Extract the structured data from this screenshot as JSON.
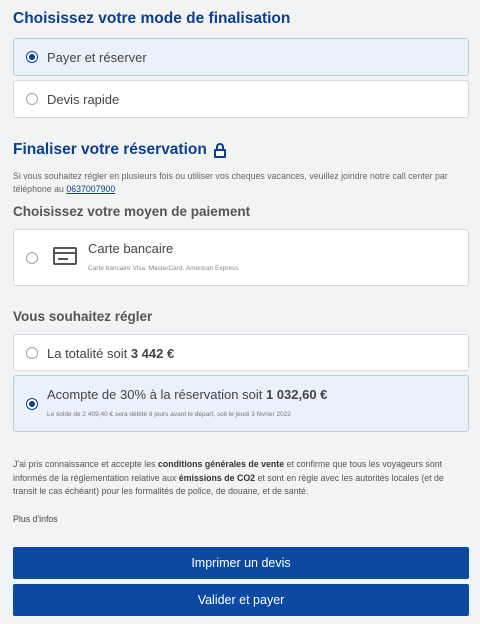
{
  "mode": {
    "title": "Choisissez votre mode de finalisation",
    "options": [
      {
        "label": "Payer et réserver",
        "selected": true
      },
      {
        "label": "Devis rapide",
        "selected": false
      }
    ]
  },
  "finalise": {
    "title": "Finaliser votre réservation",
    "installments_text": "Si vous souhaitez régler en plusieurs fois ou utiliser vos cheques vacances, veuillez joindre notre call center par téléphone au",
    "phone": "0637007900"
  },
  "payment": {
    "title": "Choisissez votre moyen de paiement",
    "card": {
      "label": "Carte bancaire",
      "sub": "Carte bancaire Visa, MasterCard, American Express",
      "icon": "credit-card-icon",
      "selected": false
    }
  },
  "settle": {
    "title": "Vous souhaitez régler",
    "total": {
      "prefix": "La totalité soit",
      "amount": "3 442 €",
      "selected": false
    },
    "deposit": {
      "prefix": "Acompte de 30% à la réservation soit",
      "amount": "1 032,60 €",
      "sub": "Le solde de 2 409,40 € sera débité 8 jours avant le départ, soit le jeudi 3 février 2022",
      "selected": true
    }
  },
  "terms": {
    "part1": "J'ai pris connaissance et accepte les",
    "link1": "conditions générales de vente",
    "part2": "et confirme que tous les voyageurs sont informés de la réglementation relative aux",
    "link2": "émissions de CO2",
    "part3": "et sont en règle avec les autorités locales (et de transit le cas échéant) pour les formalités de police, de douane, et de santé.",
    "more_info": "Plus d'infos"
  },
  "buttons": {
    "print": "Imprimer un devis",
    "validate": "Valider et payer"
  },
  "colors": {
    "accent": "#0b3f8f",
    "button": "#0b4aa2",
    "selected_bg": "#eaf1fb"
  }
}
